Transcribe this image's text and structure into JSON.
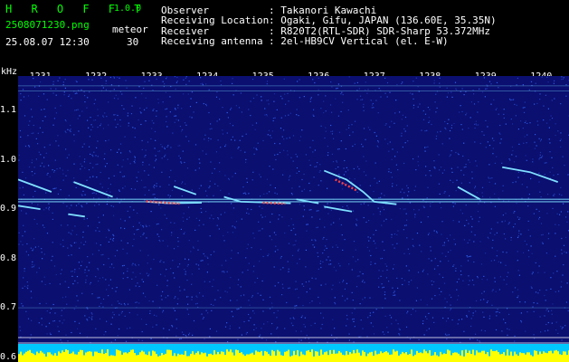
{
  "header": {
    "app_title": "H R O F F T",
    "version": "1.0.0",
    "filename": "2508071230.png",
    "datetime": "25.08.07 12:30",
    "mode_label": "meteor",
    "meteor_count": "30"
  },
  "station": {
    "observer_label": "Observer",
    "observer_value": ": Takanori Kawachi",
    "location_label": "Receiving Location",
    "location_value": ": Ogaki, Gifu, JAPAN (136.60E, 35.35N)",
    "receiver_label": "Receiver",
    "receiver_value": ": R820T2(RTL-SDR) SDR-Sharp 53.372MHz",
    "antenna_label": "Receiving antenna",
    "antenna_value": ": 2el-HB9CV Vertical (el. E-W)"
  },
  "chart_data": {
    "type": "heatmap",
    "ylabel": "kHz",
    "x_ticks": [
      "1231",
      "1232",
      "1233",
      "1234",
      "1235",
      "1236",
      "1237",
      "1238",
      "1239",
      "1240"
    ],
    "y_ticks": [
      "1.1",
      "1.0",
      "0.9",
      "0.8",
      "0.7",
      "0.6"
    ],
    "xlim": [
      1230.6,
      1240.5
    ],
    "ylim": [
      0.59,
      1.17
    ],
    "colors": {
      "background": "#0a0f70",
      "noise": "#3a6cff",
      "trace": "#7fe0ff",
      "hot": "#ff4040",
      "level_bar": "#ffff00",
      "level_base": "#00c8ff"
    },
    "meteor_traces": [
      {
        "points": [
          [
            1230.6,
            0.96
          ],
          [
            1231.2,
            0.935
          ]
        ]
      },
      {
        "points": [
          [
            1231.6,
            0.955
          ],
          [
            1232.3,
            0.925
          ]
        ]
      },
      {
        "points": [
          [
            1232.9,
            0.915
          ],
          [
            1233.3,
            0.912
          ],
          [
            1233.9,
            0.913
          ]
        ]
      },
      {
        "points": [
          [
            1233.4,
            0.946
          ],
          [
            1233.8,
            0.93
          ]
        ]
      },
      {
        "points": [
          [
            1234.3,
            0.925
          ],
          [
            1234.6,
            0.915
          ],
          [
            1235.5,
            0.912
          ]
        ]
      },
      {
        "points": [
          [
            1235.6,
            0.92
          ],
          [
            1236.0,
            0.912
          ]
        ]
      },
      {
        "points": [
          [
            1236.1,
            0.978
          ],
          [
            1236.5,
            0.96
          ],
          [
            1236.8,
            0.935
          ],
          [
            1237.0,
            0.915
          ],
          [
            1237.4,
            0.91
          ]
        ]
      },
      {
        "points": [
          [
            1236.1,
            0.905
          ],
          [
            1236.6,
            0.895
          ]
        ]
      },
      {
        "points": [
          [
            1238.5,
            0.945
          ],
          [
            1238.9,
            0.92
          ]
        ]
      },
      {
        "points": [
          [
            1239.3,
            0.985
          ],
          [
            1239.8,
            0.975
          ],
          [
            1240.3,
            0.955
          ]
        ]
      },
      {
        "points": [
          [
            1230.6,
            0.907
          ],
          [
            1231.0,
            0.9
          ]
        ]
      },
      {
        "points": [
          [
            1231.5,
            0.89
          ],
          [
            1231.8,
            0.885
          ]
        ]
      }
    ],
    "carrier_levels": [
      0.915,
      0.92,
      1.15,
      1.14,
      0.7
    ],
    "hot_segments": [
      {
        "points": [
          [
            1232.9,
            0.916
          ],
          [
            1233.5,
            0.911
          ]
        ]
      },
      {
        "points": [
          [
            1235.0,
            0.913
          ],
          [
            1235.4,
            0.911
          ]
        ]
      },
      {
        "points": [
          [
            1236.3,
            0.96
          ],
          [
            1236.7,
            0.937
          ]
        ]
      }
    ]
  }
}
